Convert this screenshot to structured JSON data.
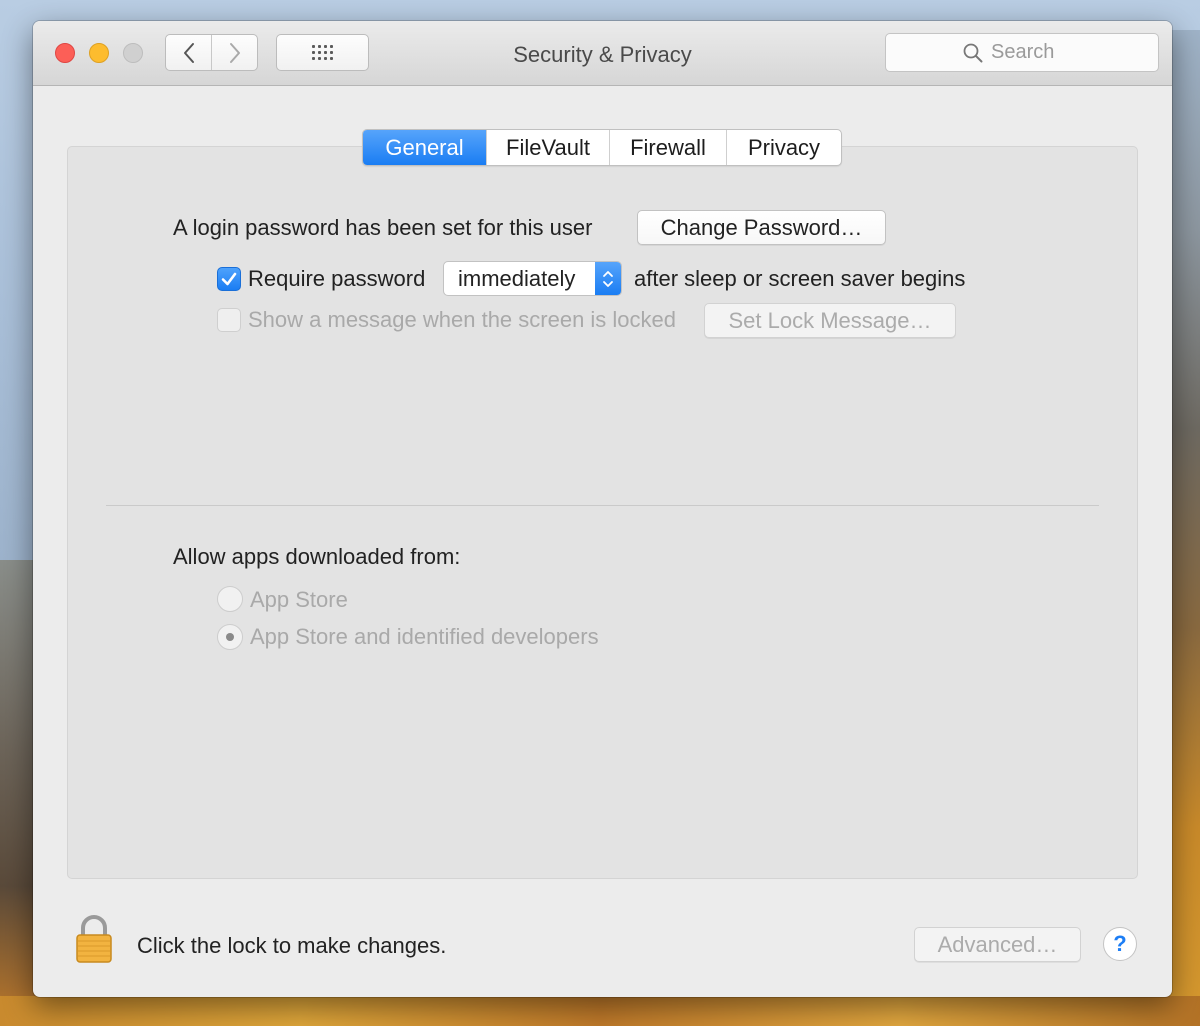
{
  "window": {
    "title": "Security & Privacy",
    "search_placeholder": "Search"
  },
  "tabs": [
    {
      "label": "General",
      "active": true
    },
    {
      "label": "FileVault",
      "active": false
    },
    {
      "label": "Firewall",
      "active": false
    },
    {
      "label": "Privacy",
      "active": false
    }
  ],
  "general": {
    "login_text": "A login password has been set for this user",
    "change_password_label": "Change Password…",
    "require_password_label": "Require password",
    "require_password_checked": true,
    "require_password_delay": "immediately",
    "after_sleep_text": "after sleep or screen saver begins",
    "show_message_label": "Show a message when the screen is locked",
    "show_message_checked": false,
    "set_lock_message_label": "Set Lock Message…"
  },
  "apps": {
    "heading": "Allow apps downloaded from:",
    "options": [
      {
        "label": "App Store",
        "selected": false
      },
      {
        "label": "App Store and identified developers",
        "selected": true
      }
    ]
  },
  "footer": {
    "lock_text": "Click the lock to make changes.",
    "advanced_label": "Advanced…",
    "help_label": "?"
  },
  "colors": {
    "accent": "#1a7df3",
    "close": "#fc5f57",
    "minimize": "#fdbc2e",
    "maximize": "#d0d0d0"
  },
  "icons": {
    "back": "chevron-left-icon",
    "forward": "chevron-right-icon",
    "show_all": "grid-icon",
    "search": "search-icon",
    "lock": "lock-icon",
    "stepper": "chevron-updown-icon",
    "check": "checkmark-icon"
  }
}
